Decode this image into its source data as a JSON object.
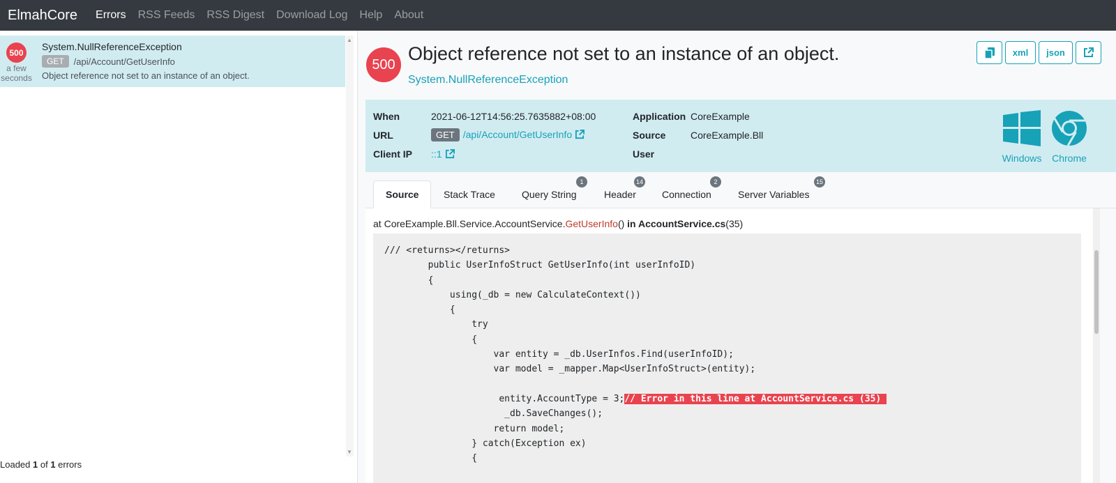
{
  "navbar": {
    "brand": "ElmahCore",
    "links": [
      "Errors",
      "RSS Feeds",
      "RSS Digest",
      "Download Log",
      "Help",
      "About"
    ],
    "active": "Errors"
  },
  "error_list": {
    "items": [
      {
        "status": "500",
        "when": "a few seconds",
        "type": "System.NullReferenceException",
        "method": "GET",
        "url": "/api/Account/GetUserInfo",
        "message": "Object reference not set to an instance of an object."
      }
    ],
    "footer": {
      "prefix": "Loaded ",
      "loaded": "1",
      "middle": " of ",
      "total": "1",
      "suffix": " errors"
    }
  },
  "detail": {
    "status": "500",
    "title": "Object reference not set to an instance of an object.",
    "type": "System.NullReferenceException",
    "buttons": {
      "copy_icon": "copy-icon",
      "xml": "xml",
      "json": "json",
      "external_icon": "external-link-icon"
    },
    "info": {
      "when_label": "When",
      "when_value": "2021-06-12T14:56:25.7635882+08:00",
      "url_label": "URL",
      "url_method": "GET",
      "url_value": "/api/Account/GetUserInfo",
      "client_ip_label": "Client IP",
      "client_ip_value": "::1",
      "application_label": "Application",
      "application_value": "CoreExample",
      "source_label": "Source",
      "source_value": "CoreExample.Bll",
      "user_label": "User",
      "user_value": "",
      "os": "Windows",
      "browser": "Chrome"
    },
    "tabs": [
      {
        "label": "Source",
        "count": null
      },
      {
        "label": "Stack Trace",
        "count": null
      },
      {
        "label": "Query String",
        "count": "1"
      },
      {
        "label": "Header",
        "count": "14"
      },
      {
        "label": "Connection",
        "count": "2"
      },
      {
        "label": "Server Variables",
        "count": "15"
      }
    ],
    "active_tab": "Source",
    "source": {
      "at": "at ",
      "namespace": "CoreExample.Bll.Service.AccountService.",
      "method": "GetUserInfo",
      "parens": "()",
      "in": " in ",
      "file": "AccountService.cs",
      "line": "(35)",
      "code_before": "/// <returns></returns>\n        public UserInfoStruct GetUserInfo(int userInfoID)\n        {\n            using(_db = new CalculateContext())\n            {\n                try\n                {\n                    var entity = _db.UserInfos.Find(userInfoID);\n                    var model = _mapper.Map<UserInfoStruct>(entity);\n\n                     entity.AccountType = 3;",
      "code_error": "// Error in this line at AccountService.cs (35) ",
      "code_after": "\n                      _db.SaveChanges();\n                    return model;\n                } catch(Exception ex)\n                {"
    }
  },
  "colors": {
    "accent": "#17a2b8",
    "danger": "#e8434f",
    "navbar": "#343a40",
    "info_bg": "#d1ecf1"
  }
}
